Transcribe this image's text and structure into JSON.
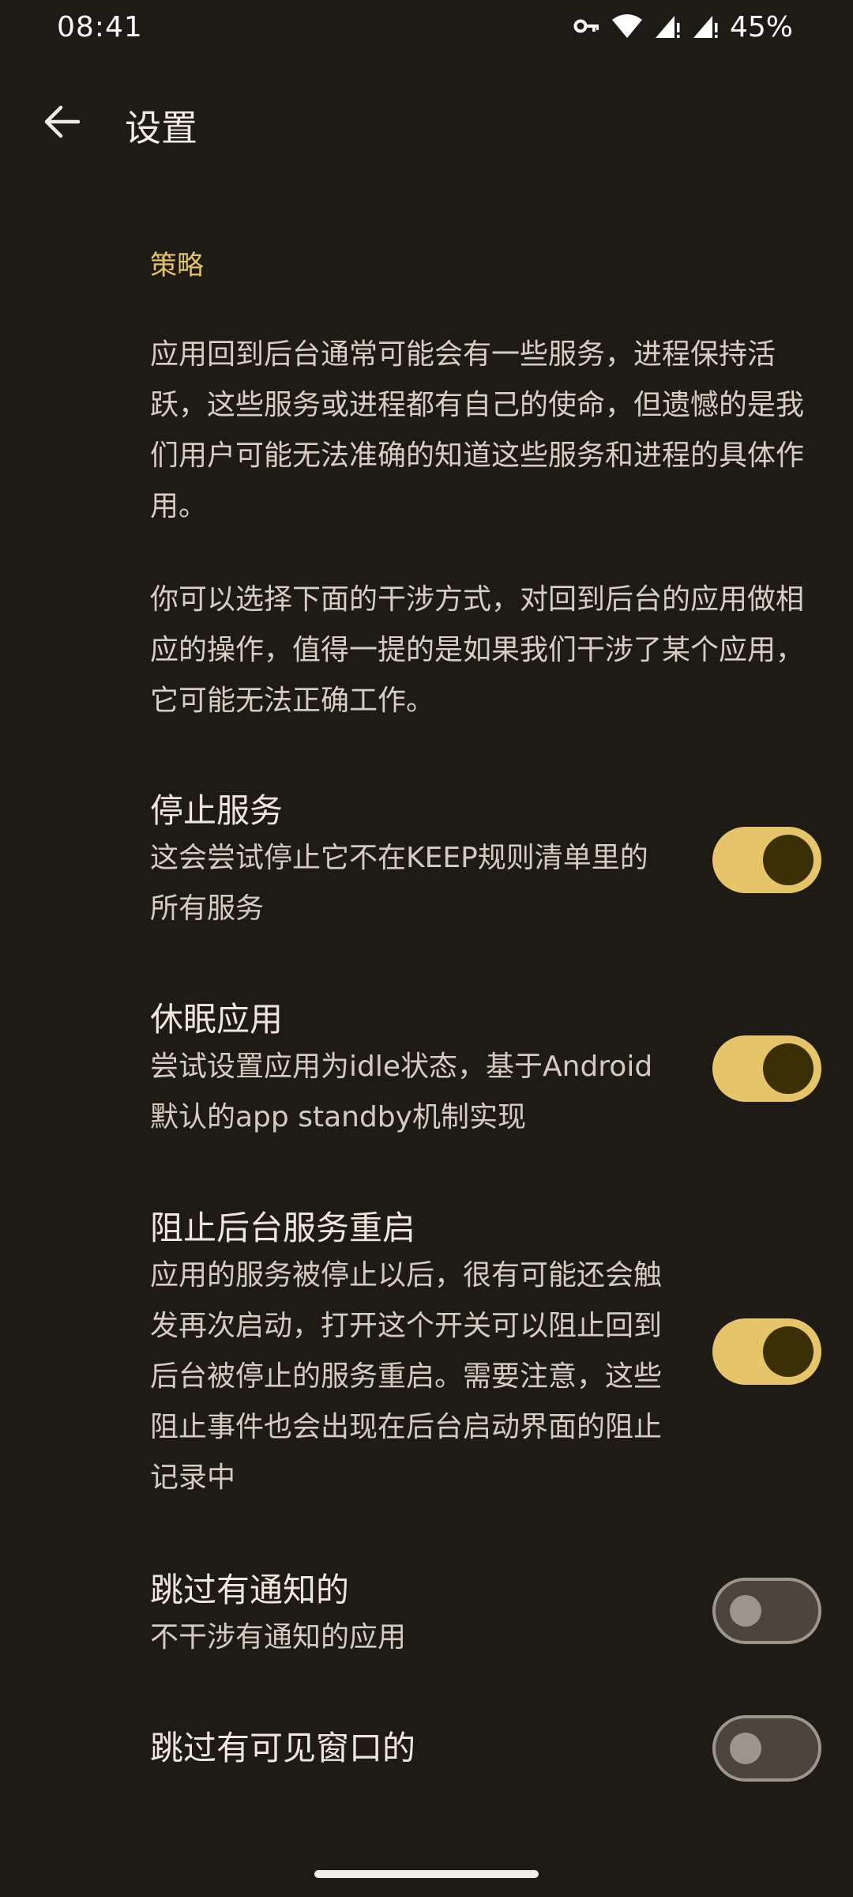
{
  "status": {
    "time": "08:41",
    "battery": "45%"
  },
  "appbar": {
    "title": "设置"
  },
  "section": {
    "header": "策略",
    "para1": "应用回到后台通常可能会有一些服务，进程保持活跃，这些服务或进程都有自己的使命，但遗憾的是我们用户可能无法准确的知道这些服务和进程的具体作用。",
    "para2": "你可以选择下面的干涉方式，对回到后台的应用做相应的操作，值得一提的是如果我们干涉了某个应用，它可能无法正确工作。"
  },
  "settings": [
    {
      "title": "停止服务",
      "summary": "这会尝试停止它不在KEEP规则清单里的所有服务",
      "on": true
    },
    {
      "title": "休眠应用",
      "summary": "尝试设置应用为idle状态，基于Android默认的app standby机制实现",
      "on": true
    },
    {
      "title": "阻止后台服务重启",
      "summary": "应用的服务被停止以后，很有可能还会触发再次启动，打开这个开关可以阻止回到后台被停止的服务重启。需要注意，这些阻止事件也会出现在后台启动界面的阻止记录中",
      "on": true
    },
    {
      "title": "跳过有通知的",
      "summary": "不干涉有通知的应用",
      "on": false
    },
    {
      "title": "跳过有可见窗口的",
      "summary": "",
      "on": false
    }
  ],
  "icons": {
    "back": "arrow-back-icon",
    "key": "vpn-key-icon",
    "wifi": "wifi-icon",
    "signal": "cell-signal-icon"
  },
  "colors": {
    "background": "#1e1b17",
    "accent": "#e6c46a",
    "switch_thumb_on": "#3a2f05"
  }
}
